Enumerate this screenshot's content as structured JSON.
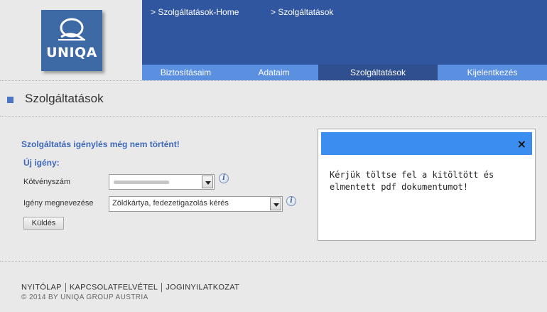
{
  "brand": {
    "logo_text": "UNIQA",
    "logo_color": "#3d6aa5"
  },
  "breadcrumb": {
    "items": [
      "> Szolgáltatások-Home",
      "> Szolgáltatások"
    ]
  },
  "nav": {
    "tabs": [
      {
        "label": "Biztosításaim",
        "active": false
      },
      {
        "label": "Adataim",
        "active": false
      },
      {
        "label": "Szolgáltatások",
        "active": true
      },
      {
        "label": "Kijelentkezés",
        "active": false
      }
    ]
  },
  "page": {
    "title": "Szolgáltatások"
  },
  "form": {
    "notice": "Szolgáltatás igénylés még nem történt!",
    "new_request_heading": "Új igény:",
    "policy_label": "Kötvényszám",
    "policy_value": "",
    "request_label": "Igény megnevezése",
    "request_value": "Zöldkártya, fedezetigazolás kérés",
    "submit_label": "Küldés"
  },
  "dialog": {
    "close_icon": "×",
    "message": "Kérjük töltse fel a kitöltött és elmentett pdf dokumentumot!"
  },
  "footer": {
    "links": [
      "NYITÓLAP",
      "KAPCSOLATFELVÉTEL",
      "JOGINYILATKOZAT"
    ],
    "copyright": "© 2014 BY UNIQA GROUP AUSTRIA"
  },
  "colors": {
    "header_blue": "#3156a0",
    "nav_blue": "#5b8fe0",
    "nav_active": "#2f4f8f",
    "accent": "#3e68b8",
    "dialog_header": "#3b8ef0"
  }
}
